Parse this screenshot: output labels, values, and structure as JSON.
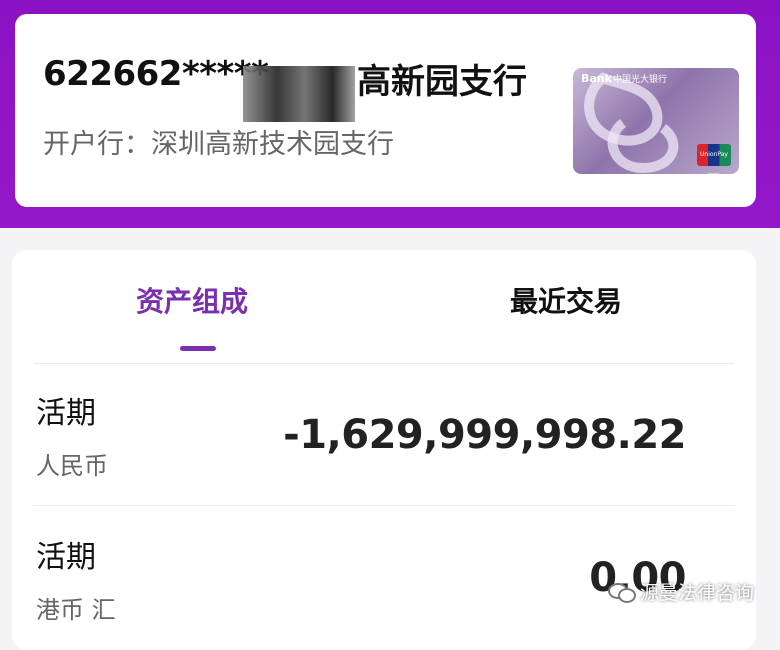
{
  "account": {
    "number_masked": "622662*****",
    "branch": "高新园支行",
    "open_bank_label": "开户行：深圳高新技术园支行",
    "card_brand": "Bank",
    "card_brand_cn": "中国光大银行",
    "card_network": "UnionPay 银联"
  },
  "tabs": [
    {
      "label": "资产组成",
      "active": true
    },
    {
      "label": "最近交易",
      "active": false
    }
  ],
  "holdings": [
    {
      "type": "活期",
      "currency": "人民币",
      "amount": "-1,629,999,998.22"
    },
    {
      "type": "活期",
      "currency": "港币 汇",
      "amount": "0.00"
    }
  ],
  "watermark": {
    "text": "源曼法律咨询"
  },
  "colors": {
    "header": "#8b12c4",
    "accent": "#7a2fb0"
  }
}
